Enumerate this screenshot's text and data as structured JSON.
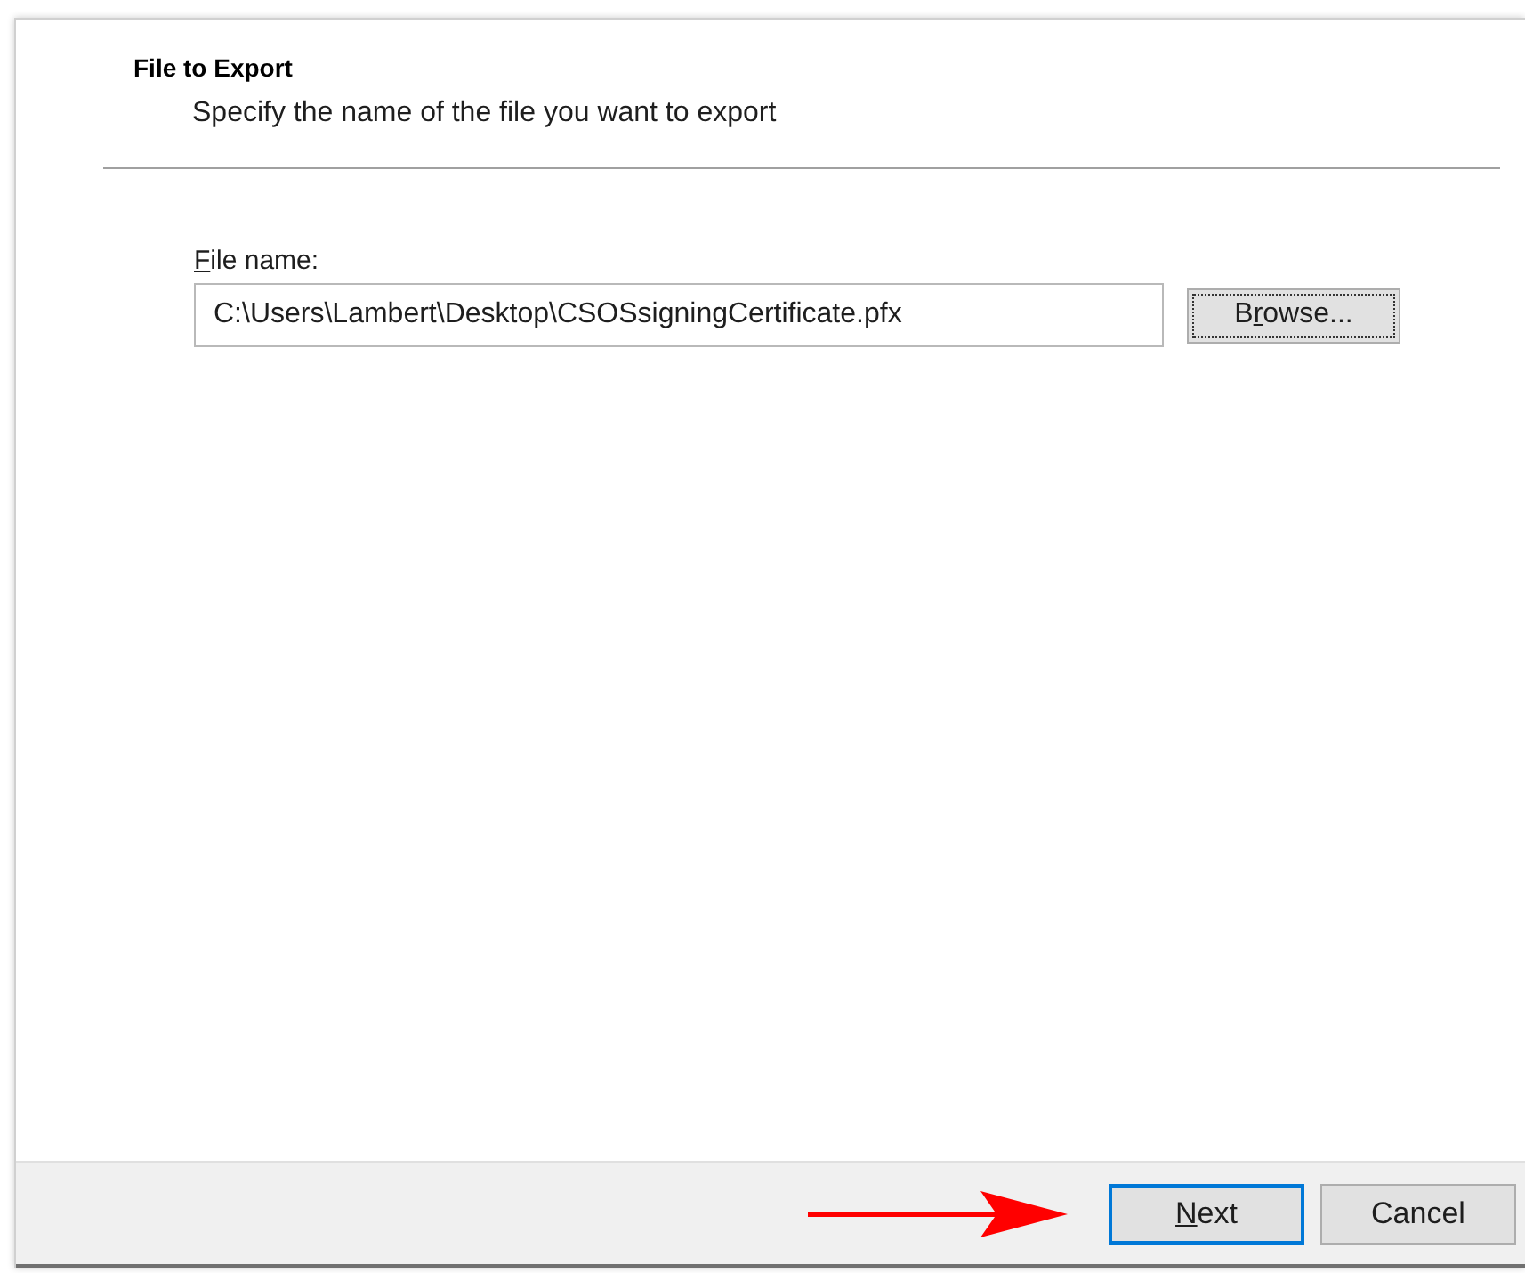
{
  "header": {
    "title": "File to Export",
    "subtitle": "Specify the name of the file you want to export"
  },
  "file_name": {
    "label": {
      "key": "F",
      "after": "ile name:"
    },
    "value": "C:\\Users\\Lambert\\Desktop\\CSOSsigningCertificate.pfx"
  },
  "browse_button": {
    "label": {
      "before": "B",
      "key": "r",
      "after": "owse..."
    },
    "focused": true
  },
  "footer_buttons": [
    {
      "label": {
        "key": "N",
        "after": "ext"
      },
      "default": true
    },
    {
      "label": {
        "before": "Cancel"
      },
      "default": false
    }
  ]
}
